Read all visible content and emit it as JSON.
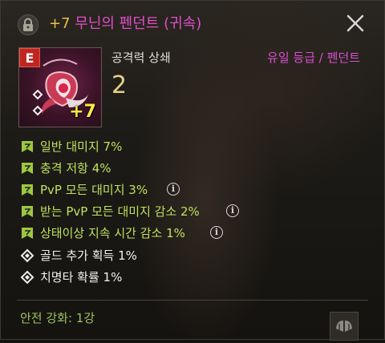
{
  "header": {
    "enhance_prefix": "+7",
    "item_name": "무닌의 펜던트 (귀속)"
  },
  "item": {
    "grade_letter": "E",
    "enhance_label": "+7",
    "stat_name": "공격력 상쇄",
    "stat_value": "2",
    "grade_type": "유일 등급 / 펜던트"
  },
  "effects": [
    {
      "text": "일반 대미지 7%",
      "icon": "green-bookmark-icon"
    },
    {
      "text": "충격 저항 4%",
      "icon": "green-bookmark-icon"
    },
    {
      "text": "PvP 모든 대미지 3%",
      "icon": "green-bookmark-icon"
    },
    {
      "text": "받는 PvP 모든 대미지 감소 2%",
      "icon": "green-bookmark-icon"
    },
    {
      "text": "상태이상 지속 시간 감소 1%",
      "icon": "green-bookmark-icon"
    },
    {
      "text": "골드 추가 획득 1%",
      "icon": "white-diamond-icon"
    },
    {
      "text": "치명타 확률 1%",
      "icon": "white-diamond-icon"
    }
  ],
  "footer": {
    "safe_enhance": "안전 강화: 1강"
  },
  "colors": {
    "title_enhance": "#e6c24a",
    "title_name": "#e04fc9",
    "effect_green": "#bfe25d",
    "grade_magenta": "#d94fd2",
    "footer_green": "#9dc35a",
    "grade_badge_red": "#c0261f"
  }
}
